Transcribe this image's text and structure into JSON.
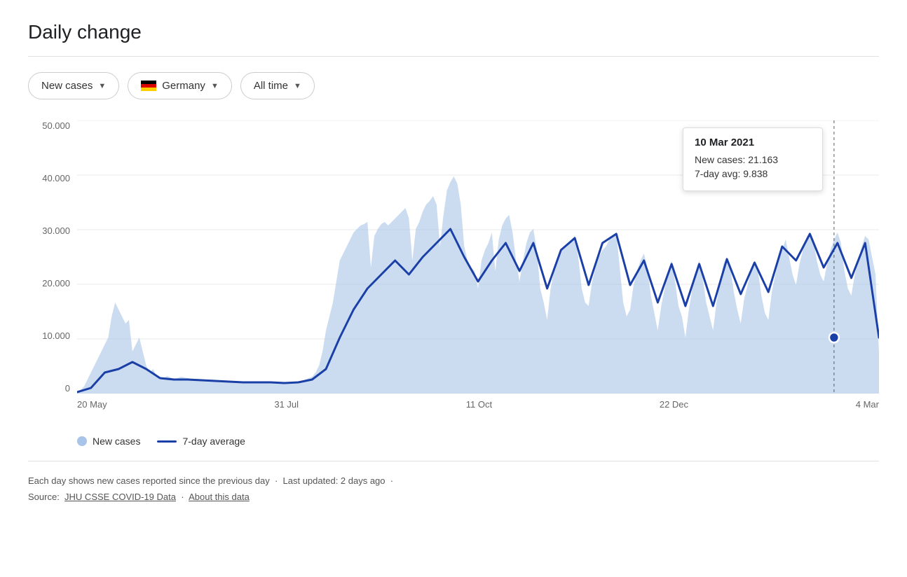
{
  "title": "Daily change",
  "controls": {
    "metric_label": "New cases",
    "country_label": "Germany",
    "timerange_label": "All time"
  },
  "chart": {
    "y_labels": [
      "50.000",
      "40.000",
      "30.000",
      "20.000",
      "10.000",
      "0"
    ],
    "x_labels": [
      "20 May",
      "31 Jul",
      "11 Oct",
      "22 Dec",
      "4 Mar"
    ],
    "tooltip": {
      "date": "10 Mar 2021",
      "new_cases_label": "New cases:",
      "new_cases_value": "21.163",
      "avg_label": "7-day avg:",
      "avg_value": "9.838"
    }
  },
  "legend": {
    "bar_label": "New cases",
    "line_label": "7-day average"
  },
  "footer": {
    "description": "Each day shows new cases reported since the previous day",
    "separator": "·",
    "updated": "Last updated: 2 days ago",
    "source_label": "Source:",
    "source_link": "JHU CSSE COVID-19 Data",
    "about_link": "About this data"
  }
}
